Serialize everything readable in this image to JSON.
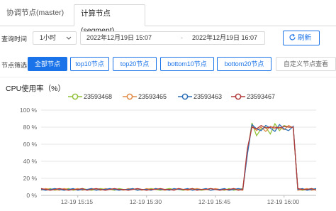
{
  "tabs": [
    {
      "label": "协调节点(master)",
      "active": false
    },
    {
      "label": "计算节点(segment)",
      "active": true
    }
  ],
  "filters": {
    "time_label": "查询时间",
    "range_select": "1小时",
    "start_time": "2022年12月19日 15:07",
    "separator": "-",
    "end_time": "2022年12月19日 16:07",
    "refresh_label": "刷新"
  },
  "node_filter": {
    "label": "节点筛选",
    "options": [
      "全部节点",
      "top10节点",
      "top20节点",
      "bottom10节点",
      "bottom20节点"
    ],
    "active_index": 0,
    "custom_label": "自定义节点查看"
  },
  "colors": {
    "accent": "#1a73e8"
  },
  "chart_data": {
    "type": "line",
    "title": "CPU使用率（%）",
    "ylim": [
      0,
      100
    ],
    "yticks": [
      "0 %",
      "20 %",
      "40 %",
      "60 %",
      "80 %",
      "100 %"
    ],
    "xlabels": [
      "12-19 15:15",
      "12-19 15:30",
      "12-19 15:45",
      "12-19 16:00"
    ],
    "x_minutes": [
      0,
      1,
      2,
      3,
      4,
      5,
      6,
      7,
      8,
      9,
      10,
      11,
      12,
      13,
      14,
      15,
      16,
      17,
      18,
      19,
      20,
      21,
      22,
      23,
      24,
      25,
      26,
      27,
      28,
      29,
      30,
      31,
      32,
      33,
      34,
      35,
      36,
      37,
      38,
      39,
      40,
      41,
      42,
      43,
      44,
      45,
      46,
      47,
      48,
      49,
      50,
      51,
      52,
      53,
      54,
      55,
      56,
      57,
      58,
      59,
      60
    ],
    "grid": true,
    "series": [
      {
        "name": "23593468",
        "color": "#91c23a",
        "values": [
          7,
          7,
          8,
          6,
          7,
          7,
          8,
          6,
          7,
          8,
          7,
          6,
          7,
          8,
          7,
          7,
          6,
          8,
          7,
          7,
          8,
          6,
          7,
          7,
          8,
          7,
          6,
          7,
          8,
          7,
          7,
          6,
          7,
          8,
          7,
          6,
          7,
          8,
          7,
          7,
          6,
          8,
          6,
          7,
          8,
          50,
          85,
          70,
          78,
          80,
          72,
          84,
          76,
          82,
          80,
          80,
          7,
          6,
          7,
          8,
          7
        ]
      },
      {
        "name": "23593465",
        "color": "#e08a45",
        "values": [
          6,
          8,
          7,
          7,
          6,
          8,
          7,
          7,
          8,
          6,
          7,
          8,
          7,
          6,
          8,
          7,
          7,
          7,
          6,
          8,
          7,
          7,
          6,
          8,
          7,
          8,
          7,
          6,
          7,
          7,
          8,
          7,
          6,
          7,
          8,
          7,
          7,
          6,
          8,
          7,
          7,
          6,
          8,
          7,
          6,
          52,
          82,
          76,
          80,
          75,
          81,
          78,
          80,
          77,
          82,
          79,
          6,
          7,
          8,
          6,
          7
        ]
      },
      {
        "name": "23593463",
        "color": "#2c6fb7",
        "values": [
          7,
          6,
          7,
          8,
          7,
          6,
          7,
          8,
          6,
          7,
          7,
          8,
          6,
          7,
          7,
          8,
          7,
          6,
          7,
          7,
          8,
          6,
          7,
          7,
          6,
          8,
          7,
          7,
          6,
          8,
          7,
          7,
          8,
          6,
          7,
          7,
          8,
          6,
          7,
          7,
          8,
          6,
          7,
          8,
          7,
          48,
          83,
          78,
          76,
          82,
          79,
          75,
          83,
          78,
          76,
          81,
          7,
          8,
          6,
          7,
          8
        ]
      },
      {
        "name": "23593467",
        "color": "#b23a3a",
        "values": [
          8,
          7,
          6,
          7,
          8,
          7,
          6,
          7,
          7,
          8,
          6,
          7,
          8,
          7,
          6,
          7,
          8,
          7,
          7,
          6,
          7,
          8,
          7,
          6,
          7,
          7,
          8,
          7,
          7,
          6,
          8,
          7,
          7,
          8,
          6,
          7,
          7,
          8,
          7,
          6,
          7,
          7,
          8,
          6,
          7,
          55,
          80,
          78,
          82,
          79,
          80,
          80,
          79,
          81,
          80,
          80,
          8,
          7,
          7,
          8,
          6
        ]
      }
    ]
  }
}
